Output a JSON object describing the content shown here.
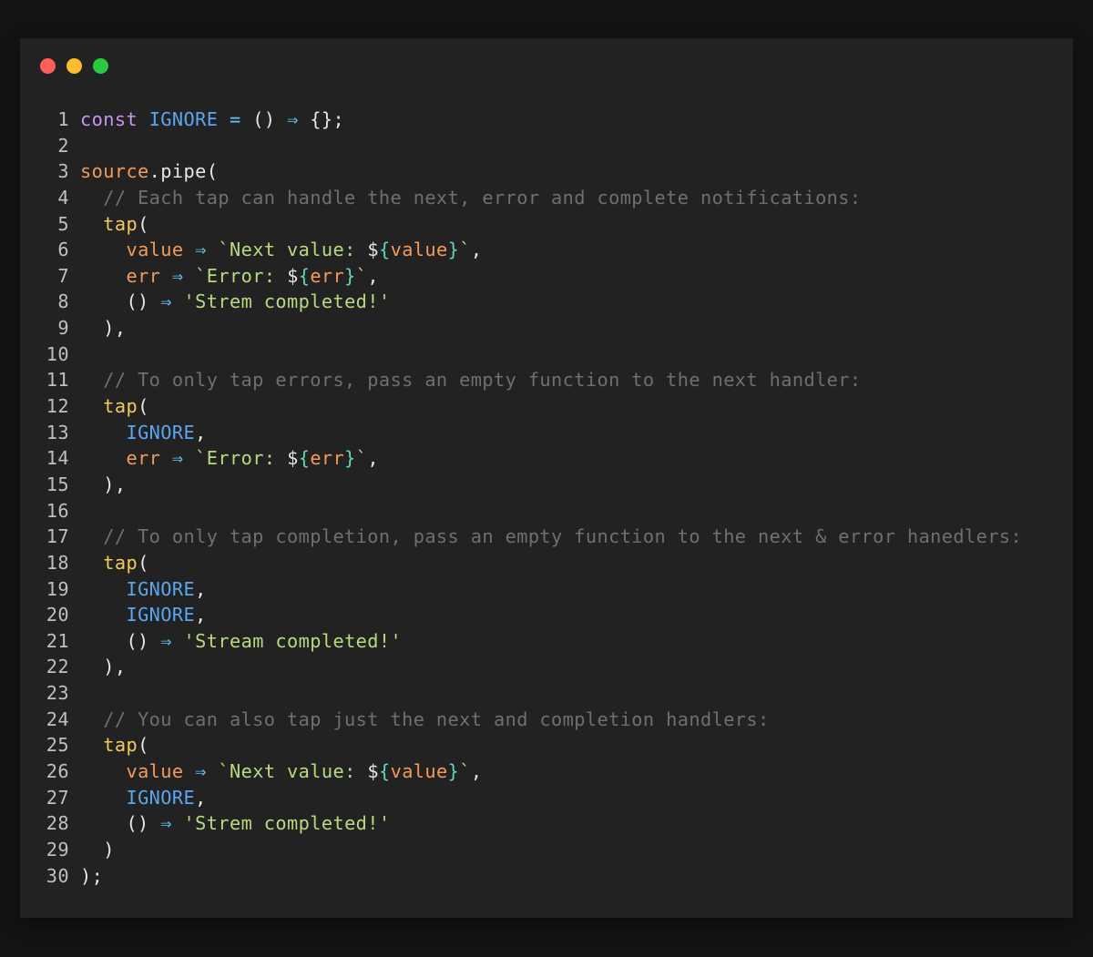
{
  "window": {
    "dots": [
      {
        "name": "close",
        "color": "#ff5f57"
      },
      {
        "name": "minimize",
        "color": "#febc2e"
      },
      {
        "name": "maximize",
        "color": "#28c840"
      }
    ]
  },
  "code": {
    "lines": [
      {
        "n": "1",
        "tokens": [
          [
            "keyword",
            "const"
          ],
          [
            "plain",
            " "
          ],
          [
            "const",
            "IGNORE"
          ],
          [
            "plain",
            " "
          ],
          [
            "op",
            "="
          ],
          [
            "plain",
            " () "
          ],
          [
            "op",
            "⇒"
          ],
          [
            "plain",
            " {};"
          ]
        ]
      },
      {
        "n": "2",
        "tokens": []
      },
      {
        "n": "3",
        "tokens": [
          [
            "var",
            "source"
          ],
          [
            "plain",
            ".pipe("
          ]
        ]
      },
      {
        "n": "4",
        "tokens": [
          [
            "plain",
            "  "
          ],
          [
            "comment",
            "// Each tap can handle the next, error and complete notifications:"
          ]
        ]
      },
      {
        "n": "5",
        "tokens": [
          [
            "plain",
            "  "
          ],
          [
            "fn",
            "tap"
          ],
          [
            "plain",
            "("
          ]
        ]
      },
      {
        "n": "6",
        "tokens": [
          [
            "plain",
            "    "
          ],
          [
            "var",
            "value"
          ],
          [
            "plain",
            " "
          ],
          [
            "op",
            "⇒"
          ],
          [
            "plain",
            " "
          ],
          [
            "string",
            "`Next value: "
          ],
          [
            "plain",
            "$"
          ],
          [
            "interp",
            "{"
          ],
          [
            "var",
            "value"
          ],
          [
            "interp",
            "}"
          ],
          [
            "string",
            "`"
          ],
          [
            "plain",
            ","
          ]
        ]
      },
      {
        "n": "7",
        "tokens": [
          [
            "plain",
            "    "
          ],
          [
            "var",
            "err"
          ],
          [
            "plain",
            " "
          ],
          [
            "op",
            "⇒"
          ],
          [
            "plain",
            " "
          ],
          [
            "string",
            "`Error: "
          ],
          [
            "plain",
            "$"
          ],
          [
            "interp",
            "{"
          ],
          [
            "var",
            "err"
          ],
          [
            "interp",
            "}"
          ],
          [
            "string",
            "`"
          ],
          [
            "plain",
            ","
          ]
        ]
      },
      {
        "n": "8",
        "tokens": [
          [
            "plain",
            "    () "
          ],
          [
            "op",
            "⇒"
          ],
          [
            "plain",
            " "
          ],
          [
            "string",
            "'Strem completed!'"
          ]
        ]
      },
      {
        "n": "9",
        "tokens": [
          [
            "plain",
            "  ),"
          ]
        ]
      },
      {
        "n": "10",
        "tokens": []
      },
      {
        "n": "11",
        "tokens": [
          [
            "plain",
            "  "
          ],
          [
            "comment",
            "// To only tap errors, pass an empty function to the next handler:"
          ]
        ]
      },
      {
        "n": "12",
        "tokens": [
          [
            "plain",
            "  "
          ],
          [
            "fn",
            "tap"
          ],
          [
            "plain",
            "("
          ]
        ]
      },
      {
        "n": "13",
        "tokens": [
          [
            "plain",
            "    "
          ],
          [
            "const",
            "IGNORE"
          ],
          [
            "plain",
            ","
          ]
        ]
      },
      {
        "n": "14",
        "tokens": [
          [
            "plain",
            "    "
          ],
          [
            "var",
            "err"
          ],
          [
            "plain",
            " "
          ],
          [
            "op",
            "⇒"
          ],
          [
            "plain",
            " "
          ],
          [
            "string",
            "`Error: "
          ],
          [
            "plain",
            "$"
          ],
          [
            "interp",
            "{"
          ],
          [
            "var",
            "err"
          ],
          [
            "interp",
            "}"
          ],
          [
            "string",
            "`"
          ],
          [
            "plain",
            ","
          ]
        ]
      },
      {
        "n": "15",
        "tokens": [
          [
            "plain",
            "  ),"
          ]
        ]
      },
      {
        "n": "16",
        "tokens": []
      },
      {
        "n": "17",
        "tokens": [
          [
            "plain",
            "  "
          ],
          [
            "comment",
            "// To only tap completion, pass an empty function to the next & error hanedlers:"
          ]
        ]
      },
      {
        "n": "18",
        "tokens": [
          [
            "plain",
            "  "
          ],
          [
            "fn",
            "tap"
          ],
          [
            "plain",
            "("
          ]
        ]
      },
      {
        "n": "19",
        "tokens": [
          [
            "plain",
            "    "
          ],
          [
            "const",
            "IGNORE"
          ],
          [
            "plain",
            ","
          ]
        ]
      },
      {
        "n": "20",
        "tokens": [
          [
            "plain",
            "    "
          ],
          [
            "const",
            "IGNORE"
          ],
          [
            "plain",
            ","
          ]
        ]
      },
      {
        "n": "21",
        "tokens": [
          [
            "plain",
            "    () "
          ],
          [
            "op",
            "⇒"
          ],
          [
            "plain",
            " "
          ],
          [
            "string",
            "'Stream completed!'"
          ]
        ]
      },
      {
        "n": "22",
        "tokens": [
          [
            "plain",
            "  ),"
          ]
        ]
      },
      {
        "n": "23",
        "tokens": []
      },
      {
        "n": "24",
        "tokens": [
          [
            "plain",
            "  "
          ],
          [
            "comment",
            "// You can also tap just the next and completion handlers:"
          ]
        ]
      },
      {
        "n": "25",
        "tokens": [
          [
            "plain",
            "  "
          ],
          [
            "fn",
            "tap"
          ],
          [
            "plain",
            "("
          ]
        ]
      },
      {
        "n": "26",
        "tokens": [
          [
            "plain",
            "    "
          ],
          [
            "var",
            "value"
          ],
          [
            "plain",
            " "
          ],
          [
            "op",
            "⇒"
          ],
          [
            "plain",
            " "
          ],
          [
            "string",
            "`Next value: "
          ],
          [
            "plain",
            "$"
          ],
          [
            "interp",
            "{"
          ],
          [
            "var",
            "value"
          ],
          [
            "interp",
            "}"
          ],
          [
            "string",
            "`"
          ],
          [
            "plain",
            ","
          ]
        ]
      },
      {
        "n": "27",
        "tokens": [
          [
            "plain",
            "    "
          ],
          [
            "const",
            "IGNORE"
          ],
          [
            "plain",
            ","
          ]
        ]
      },
      {
        "n": "28",
        "tokens": [
          [
            "plain",
            "    () "
          ],
          [
            "op",
            "⇒"
          ],
          [
            "plain",
            " "
          ],
          [
            "string",
            "'Strem completed!'"
          ]
        ]
      },
      {
        "n": "29",
        "tokens": [
          [
            "plain",
            "  )"
          ]
        ]
      },
      {
        "n": "30",
        "tokens": [
          [
            "plain",
            ");"
          ]
        ]
      }
    ]
  },
  "colors": {
    "background": "#141414",
    "window": "#222222",
    "keyword": "#c994f2",
    "constant": "#5aa6ef",
    "operator": "#5fc7f0",
    "variable": "#f39a5a",
    "function": "#f2c95b",
    "string": "#b7da7e",
    "interpolation": "#5fd6b8",
    "comment": "#6f6f6f"
  }
}
